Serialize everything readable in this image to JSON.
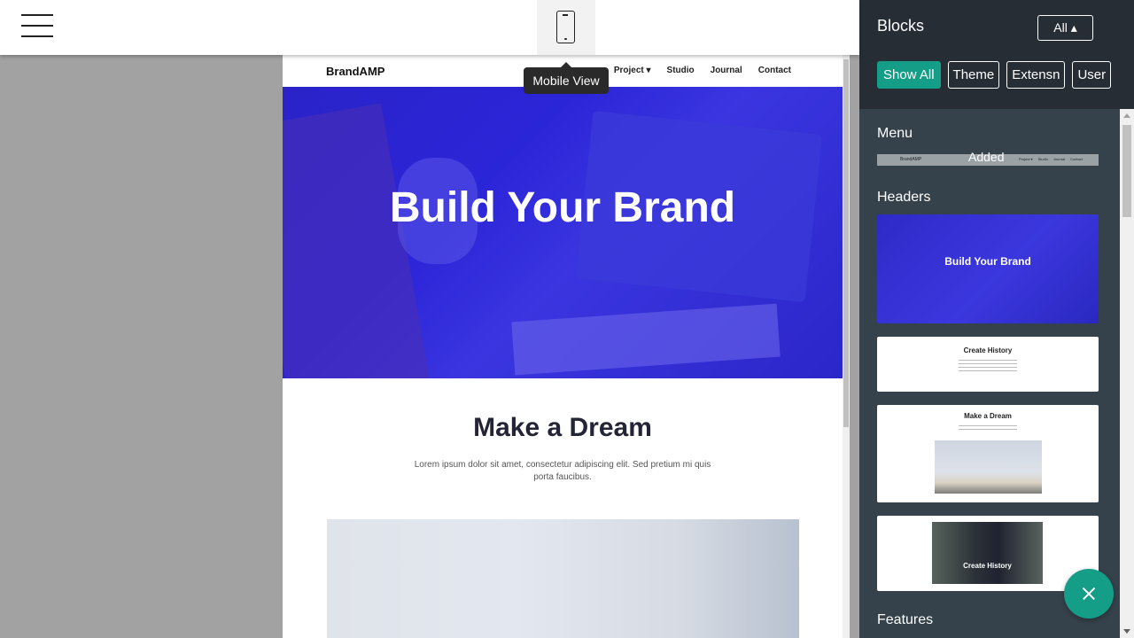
{
  "toolbar": {
    "menu_icon": "hamburger-icon",
    "mobile_icon": "mobile-phone-icon",
    "tooltip": "Mobile View"
  },
  "site": {
    "brand": "BrandAMP",
    "nav": [
      "Project ▾",
      "Studio",
      "Journal",
      "Contact"
    ],
    "hero_title": "Build Your Brand",
    "hero_color": "#2b25d8",
    "section_title": "Make a Dream",
    "section_text": "Lorem ipsum dolor sit amet, consectetur adipiscing elit. Sed pretium mi quis porta faucibus."
  },
  "panel": {
    "title": "Blocks",
    "dropdown": "All ▴",
    "filters": [
      "Show All",
      "Theme",
      "Extensn",
      "User"
    ],
    "active_filter": "Show All",
    "accent": "#149d87",
    "sections": {
      "menu": "Menu",
      "headers": "Headers",
      "features": "Features"
    },
    "menu_thumb": {
      "brand": "BrandAMP",
      "links": [
        "Project ▾",
        "Studio",
        "Journal",
        "Contact"
      ],
      "status": "Added"
    },
    "header_thumbs": [
      "Build Your Brand",
      "Create History",
      "Make a Dream",
      "Create History"
    ]
  },
  "fab_icon": "close-icon"
}
